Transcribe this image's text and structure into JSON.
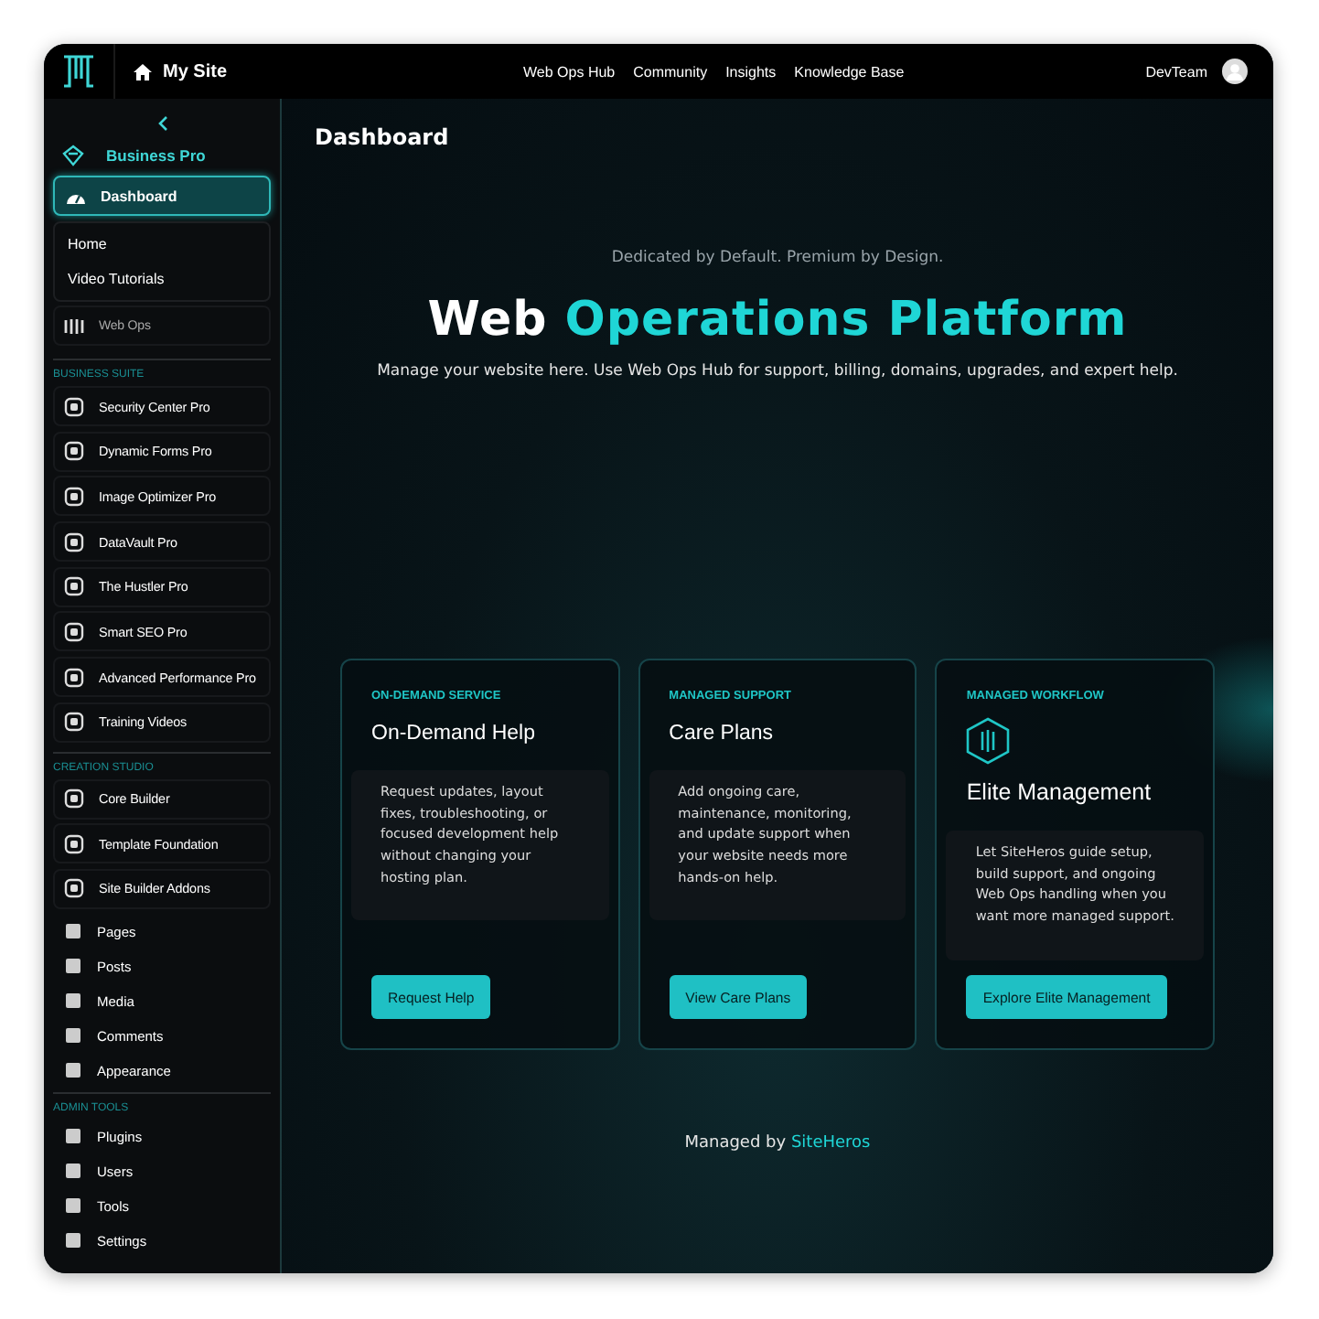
{
  "topbar": {
    "site": "My Site",
    "nav": [
      {
        "label": "Web Ops Hub"
      },
      {
        "label": "Community"
      },
      {
        "label": "Insights"
      },
      {
        "label": "Knowledge Base"
      }
    ],
    "user": "DevTeam"
  },
  "sidebar": {
    "brand": "Business Pro",
    "menu": [
      {
        "label": "Dashboard",
        "selected": true
      },
      {
        "label": "Home",
        "selected": false
      },
      {
        "label": "Video Tutorials",
        "selected": false
      }
    ],
    "web_ops": "Web Ops",
    "sections": [
      {
        "title": "BUSINESS SUITE",
        "items": [
          {
            "label": "Security Center Pro",
            "kind": "card"
          },
          {
            "label": "Dynamic Forms Pro",
            "kind": "card"
          },
          {
            "label": "Image Optimizer Pro",
            "kind": "card"
          },
          {
            "label": "DataVault Pro",
            "kind": "card"
          },
          {
            "label": "The Hustler Pro",
            "kind": "card"
          },
          {
            "label": "Smart SEO Pro",
            "kind": "card"
          },
          {
            "label": "Advanced Performance Pro",
            "kind": "card"
          },
          {
            "label": "Training Videos",
            "kind": "card"
          }
        ]
      },
      {
        "title": "CREATION STUDIO",
        "items": [
          {
            "label": "Core Builder",
            "kind": "card"
          },
          {
            "label": "Template Foundation",
            "kind": "card"
          },
          {
            "label": "Site Builder Addons",
            "kind": "card"
          },
          {
            "label": "Pages",
            "kind": "plain"
          },
          {
            "label": "Posts",
            "kind": "plain"
          },
          {
            "label": "Media",
            "kind": "plain"
          },
          {
            "label": "Comments",
            "kind": "plain"
          },
          {
            "label": "Appearance",
            "kind": "plain"
          }
        ]
      },
      {
        "title": "ADMIN TOOLS",
        "items": [
          {
            "label": "Plugins",
            "kind": "plain"
          },
          {
            "label": "Users",
            "kind": "plain"
          },
          {
            "label": "Tools",
            "kind": "plain"
          },
          {
            "label": "Settings",
            "kind": "plain"
          }
        ]
      }
    ]
  },
  "main": {
    "page_title": "Dashboard",
    "tagline": "Dedicated by Default. Premium by Design.",
    "title_lead": "Web",
    "title_accent": "Operations Platform",
    "intro": "Manage your website here. Use Web Ops Hub for support, billing, domains, upgrades, and expert help.",
    "cards": [
      {
        "eyebrow": "ON-DEMAND SERVICE",
        "title": "On-Demand Help",
        "icon": false,
        "text": "Request updates, layout fixes, troubleshooting, or focused development help without changing your hosting plan.",
        "button": "Request Help"
      },
      {
        "eyebrow": "MANAGED SUPPORT",
        "title": "Care Plans",
        "icon": false,
        "text": "Add ongoing care, maintenance, monitoring, and update support when your website needs more hands-on help.",
        "button": "View Care Plans"
      },
      {
        "eyebrow": "MANAGED WORKFLOW",
        "title": "Elite Management",
        "icon": true,
        "text": "Let SiteHeros guide setup, build support, and ongoing Web Ops handling when you want more managed support.",
        "button": "Explore Elite Management"
      }
    ],
    "footer_text": "Managed by",
    "footer_link": "SiteHeros"
  }
}
